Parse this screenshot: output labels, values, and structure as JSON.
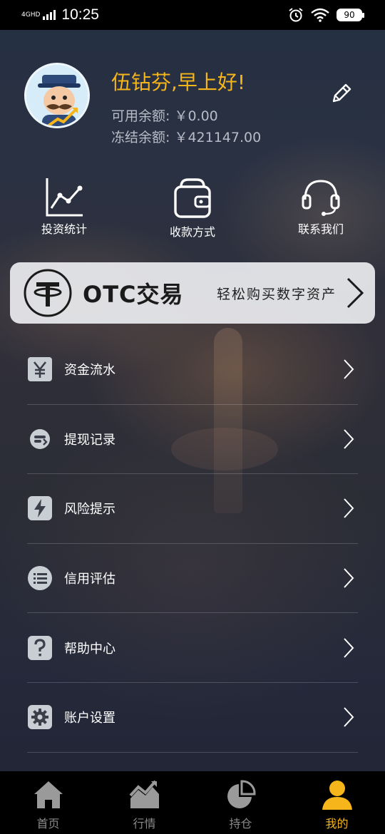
{
  "status_bar": {
    "network": "4GHD",
    "time": "10:25",
    "battery": "90"
  },
  "profile": {
    "greeting": "伍钻芬,早上好!",
    "available_balance": "可用余额: ￥0.00",
    "frozen_balance": "冻结余额: ￥421147.00"
  },
  "quick_actions": [
    {
      "label": "投资统计",
      "icon": "line-chart-icon"
    },
    {
      "label": "收款方式",
      "icon": "wallet-icon"
    },
    {
      "label": "联系我们",
      "icon": "headset-icon"
    }
  ],
  "otc_banner": {
    "title": "OTC交易",
    "subtitle": "轻松购买数字资产",
    "icon": "tether-icon"
  },
  "menu": [
    {
      "label": "资金流水",
      "icon": "yuan-icon"
    },
    {
      "label": "提现记录",
      "icon": "withdraw-icon"
    },
    {
      "label": "风险提示",
      "icon": "lightning-icon"
    },
    {
      "label": "信用评估",
      "icon": "list-icon"
    },
    {
      "label": "帮助中心",
      "icon": "question-icon"
    },
    {
      "label": "账户设置",
      "icon": "gear-icon"
    }
  ],
  "tabbar": {
    "active_index": 3,
    "active_color": "#f5b51b",
    "tabs": [
      {
        "label": "首页",
        "icon": "home-icon"
      },
      {
        "label": "行情",
        "icon": "market-chart-icon"
      },
      {
        "label": "持仓",
        "icon": "pie-chart-icon"
      },
      {
        "label": "我的",
        "icon": "person-icon"
      }
    ]
  }
}
